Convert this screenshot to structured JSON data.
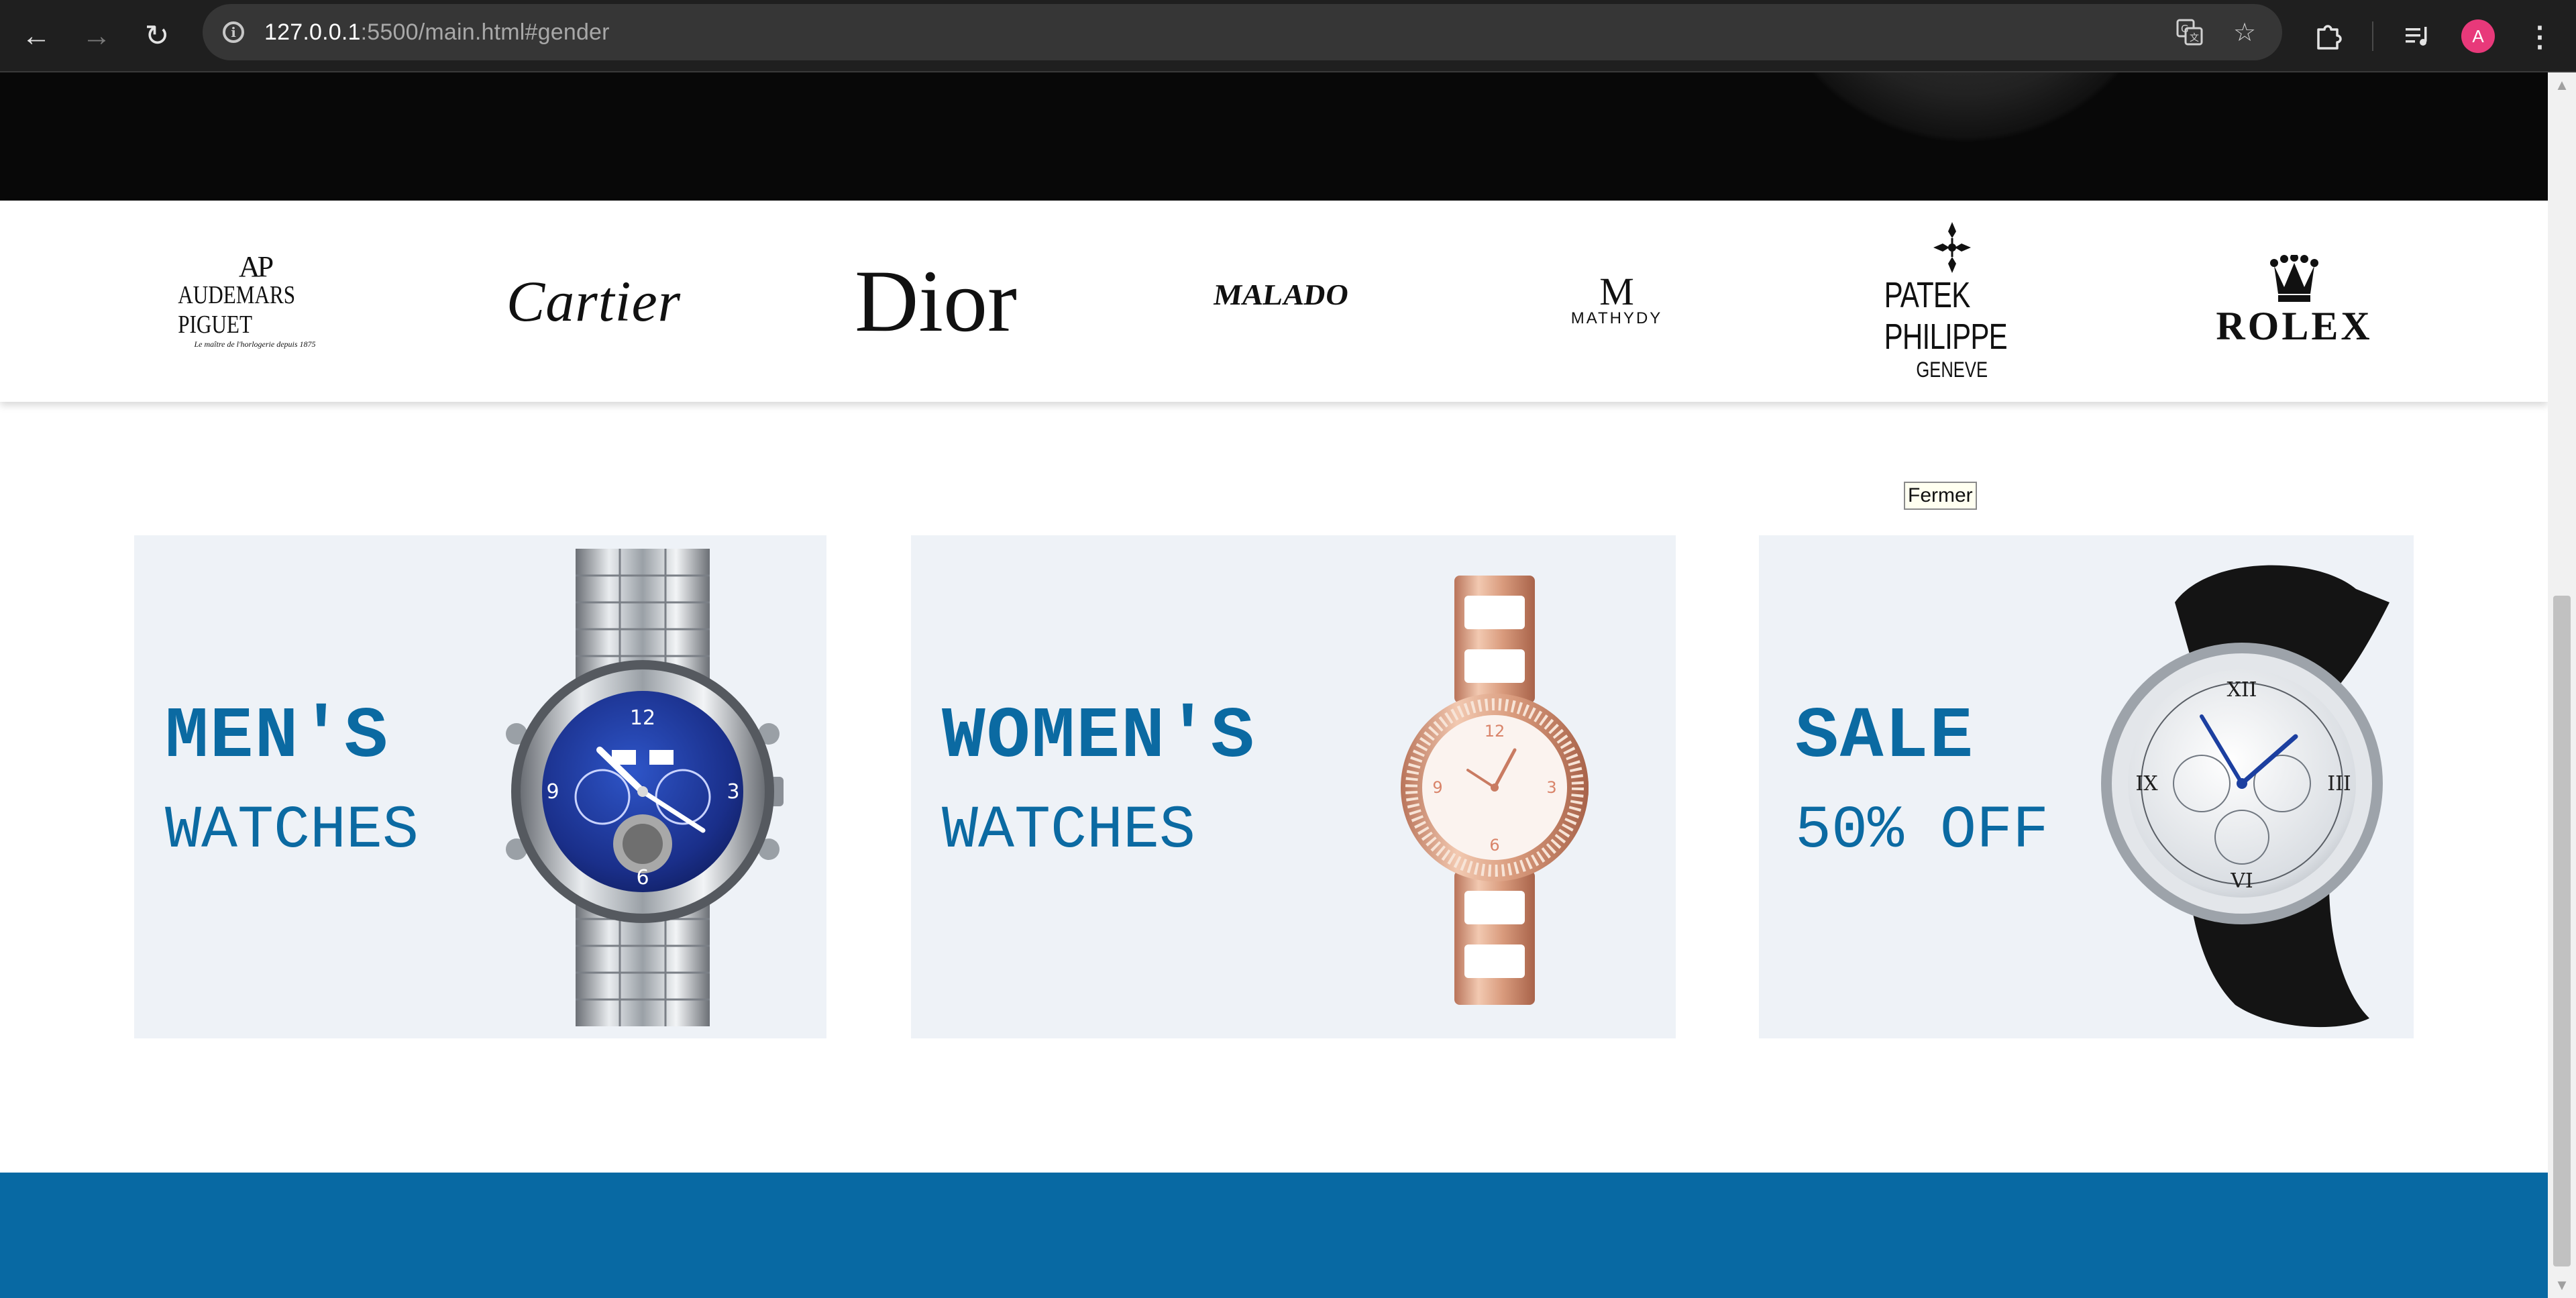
{
  "browser": {
    "url_host": "127.0.0.1",
    "url_path": ":5500/main.html#gender",
    "back_icon": "arrow-left-icon",
    "forward_icon": "arrow-right-icon",
    "reload_icon": "reload-icon",
    "site_info_icon": "info-icon",
    "translate_icon": "translate-icon",
    "bookmark_icon": "star-icon",
    "extensions_icon": "puzzle-icon",
    "media_icon": "playlist-icon",
    "profile_initial": "A",
    "menu_icon": "kebab-menu-icon"
  },
  "brands": [
    {
      "name": "AUDEMARS PIGUET",
      "monogram": "AP",
      "tagline": "Le maître de l'horlogerie depuis 1875"
    },
    {
      "name": "Cartier"
    },
    {
      "name": "Dior"
    },
    {
      "name": "MALADO"
    },
    {
      "name": "MATHYDY",
      "monogram": "M"
    },
    {
      "name": "PATEK PHILIPPE",
      "city": "GENEVE"
    },
    {
      "name": "ROLEX"
    }
  ],
  "tooltip": "Fermer",
  "cards": [
    {
      "title": "MEN'S",
      "subtitle": "WATCHES"
    },
    {
      "title": "WOMEN'S",
      "subtitle": "WATCHES"
    },
    {
      "title": "SALE",
      "subtitle": "50% OFF"
    }
  ],
  "colors": {
    "accent_blue": "#0b6aa2",
    "footer_blue": "#0869a3",
    "card_bg": "#eef2f7",
    "hero_bg": "#080808"
  }
}
